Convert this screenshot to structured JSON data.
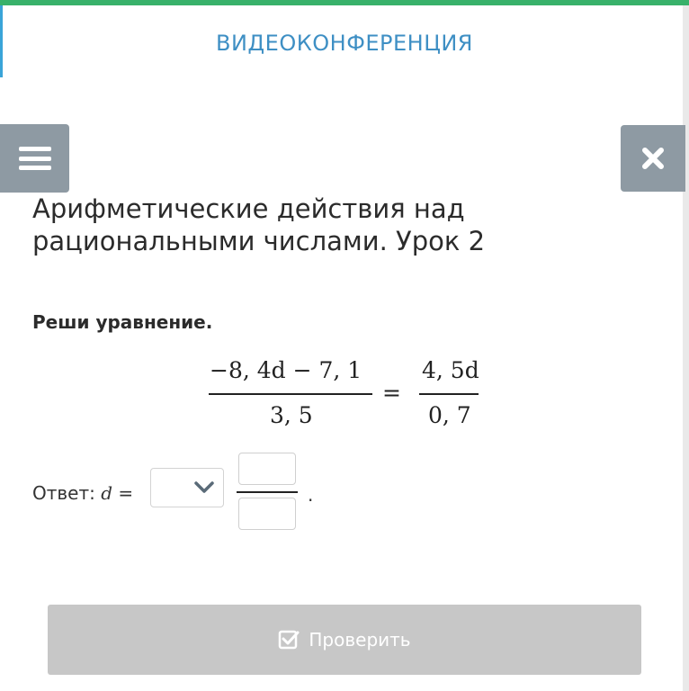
{
  "header": {
    "title": "ВИДЕОКОНФЕРЕНЦИЯ"
  },
  "icons": {
    "menu": "hamburger-menu-icon",
    "close": "close-x-icon",
    "dropdown": "chevron-down-icon",
    "check": "checkbox-checked-icon"
  },
  "colors": {
    "accent_green": "#38b16a",
    "header_blue": "#3e8fc4",
    "side_button": "#8e9aa3",
    "check_button": "#c7c7c7"
  },
  "lesson": {
    "title": "Арифметические действия над рациональными числами. Урок 2"
  },
  "task": {
    "label": "Реши уравнение.",
    "equation": {
      "left_numerator": "−8, 4d  − 7, 1",
      "left_denominator": "3, 5",
      "equals": "=",
      "right_numerator": "4, 5d",
      "right_denominator": "0, 7"
    }
  },
  "answer": {
    "label": "Ответ:",
    "variable": "d",
    "equals": "=",
    "sign_value": "",
    "numerator_value": "",
    "denominator_value": "",
    "period": "."
  },
  "check_button": {
    "label": "Проверить"
  }
}
